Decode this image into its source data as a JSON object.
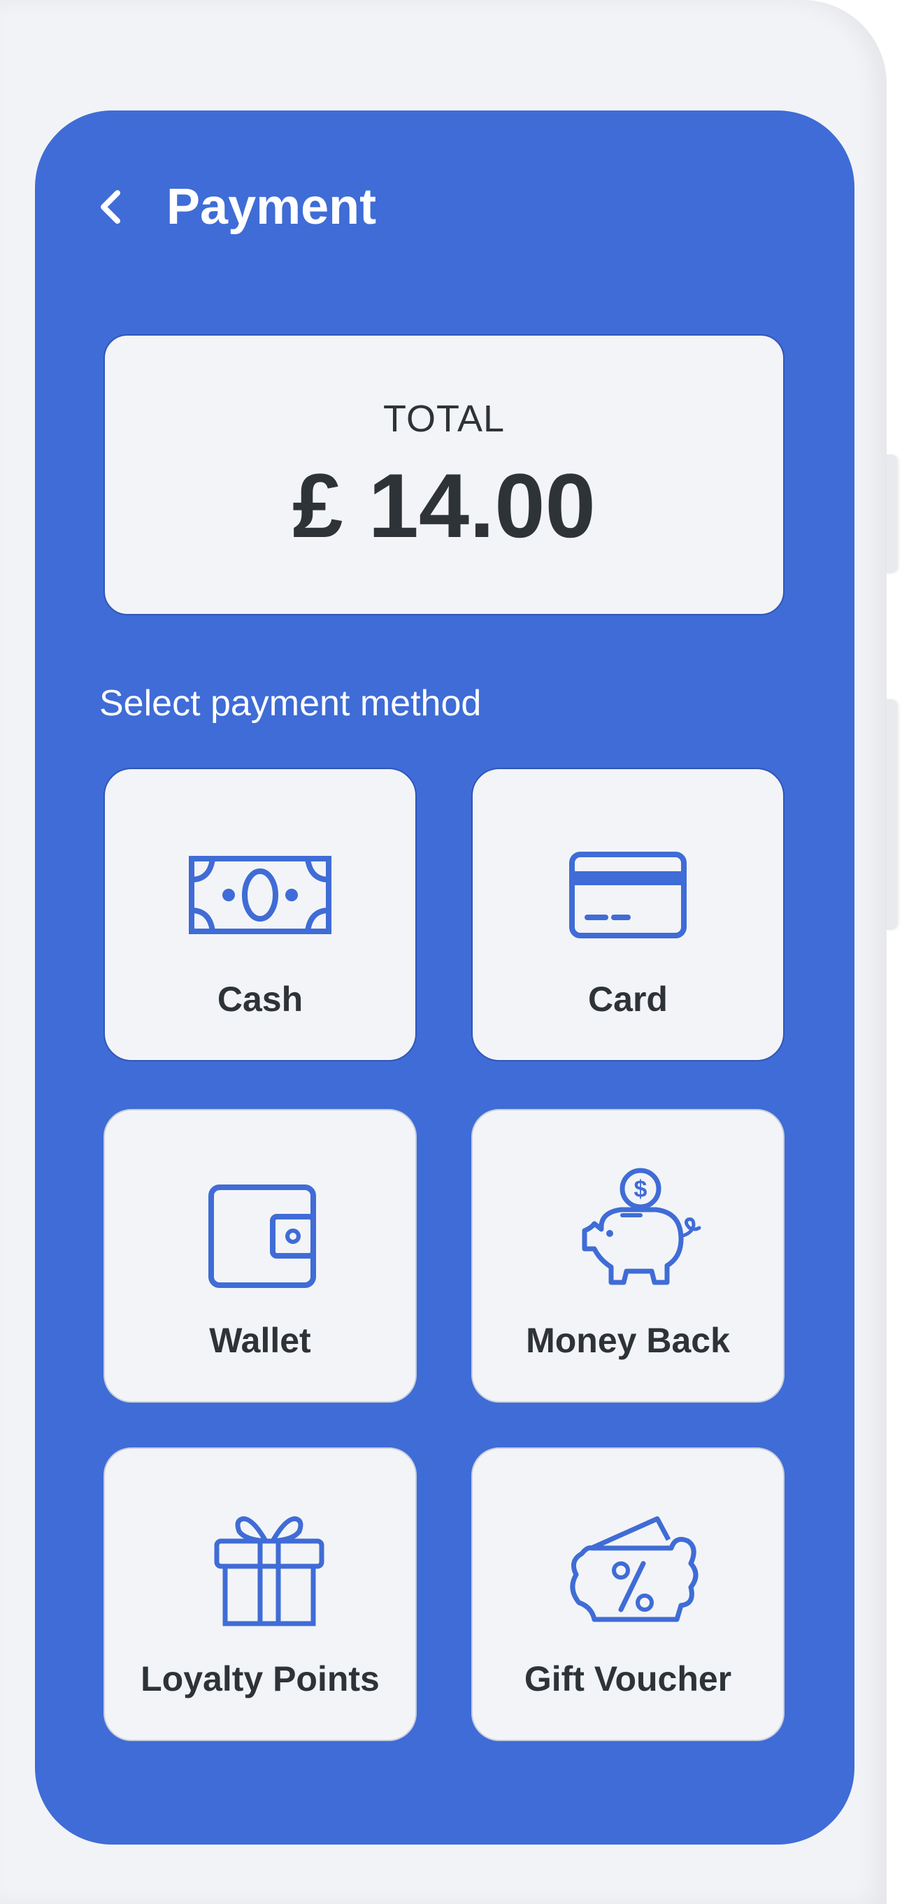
{
  "header": {
    "back_icon": "chevron-left-icon",
    "title": "Payment"
  },
  "total": {
    "label": "TOTAL",
    "amount": "£ 14.00"
  },
  "section": {
    "label": "Select payment method"
  },
  "methods": [
    {
      "label": "Cash",
      "icon": "cash-icon"
    },
    {
      "label": "Card",
      "icon": "credit-card-icon"
    },
    {
      "label": "Wallet",
      "icon": "wallet-icon"
    },
    {
      "label": "Money Back",
      "icon": "piggy-bank-icon"
    },
    {
      "label": "Loyalty Points",
      "icon": "gift-icon"
    },
    {
      "label": "Gift Voucher",
      "icon": "voucher-icon"
    }
  ],
  "colors": {
    "accent": "#3f6cd6",
    "card_bg": "#f3f4f7",
    "text_dark": "#2e3338",
    "icon_blue": "#3f6cd6"
  }
}
